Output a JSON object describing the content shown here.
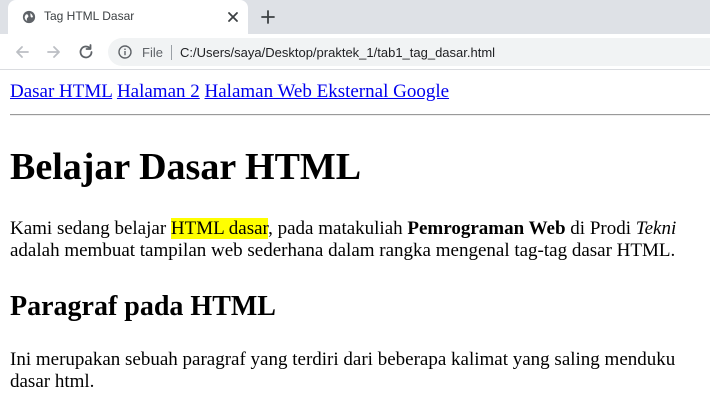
{
  "browser": {
    "tab_title": "Tag HTML Dasar",
    "address_scheme_label": "File",
    "address_url": "C:/Users/saya/Desktop/praktek_1/tab1_tag_dasar.html"
  },
  "page": {
    "nav_links": [
      "Dasar HTML",
      "Halaman 2",
      "Halaman Web Eksternal Google"
    ],
    "heading1": "Belajar Dasar HTML",
    "paragraph1": {
      "text_before_highlight": "Kami sedang belajar ",
      "highlight": "HTML dasar",
      "text_after_highlight": ", pada matakuliah ",
      "bold": "Pemrograman Web",
      "text_after_bold": " di Prodi ",
      "italic": "Tekni",
      "line2": "adalah membuat tampilan web sederhana dalam rangka mengenal tag-tag dasar HTML."
    },
    "heading2": "Paragraf pada HTML",
    "paragraph2": {
      "line1": "Ini merupakan sebuah paragraf yang terdiri dari beberapa kalimat yang saling menduku",
      "line2": "dasar html."
    }
  },
  "colors": {
    "link": "#0000ee",
    "highlight": "#ffff00",
    "tabstrip": "#dee1e6"
  },
  "icons": {
    "favicon": "globe-icon",
    "tab_close": "close-icon",
    "new_tab": "plus-icon",
    "back": "back-arrow-icon",
    "forward": "forward-arrow-icon",
    "reload": "reload-icon",
    "site_info": "info-icon"
  }
}
